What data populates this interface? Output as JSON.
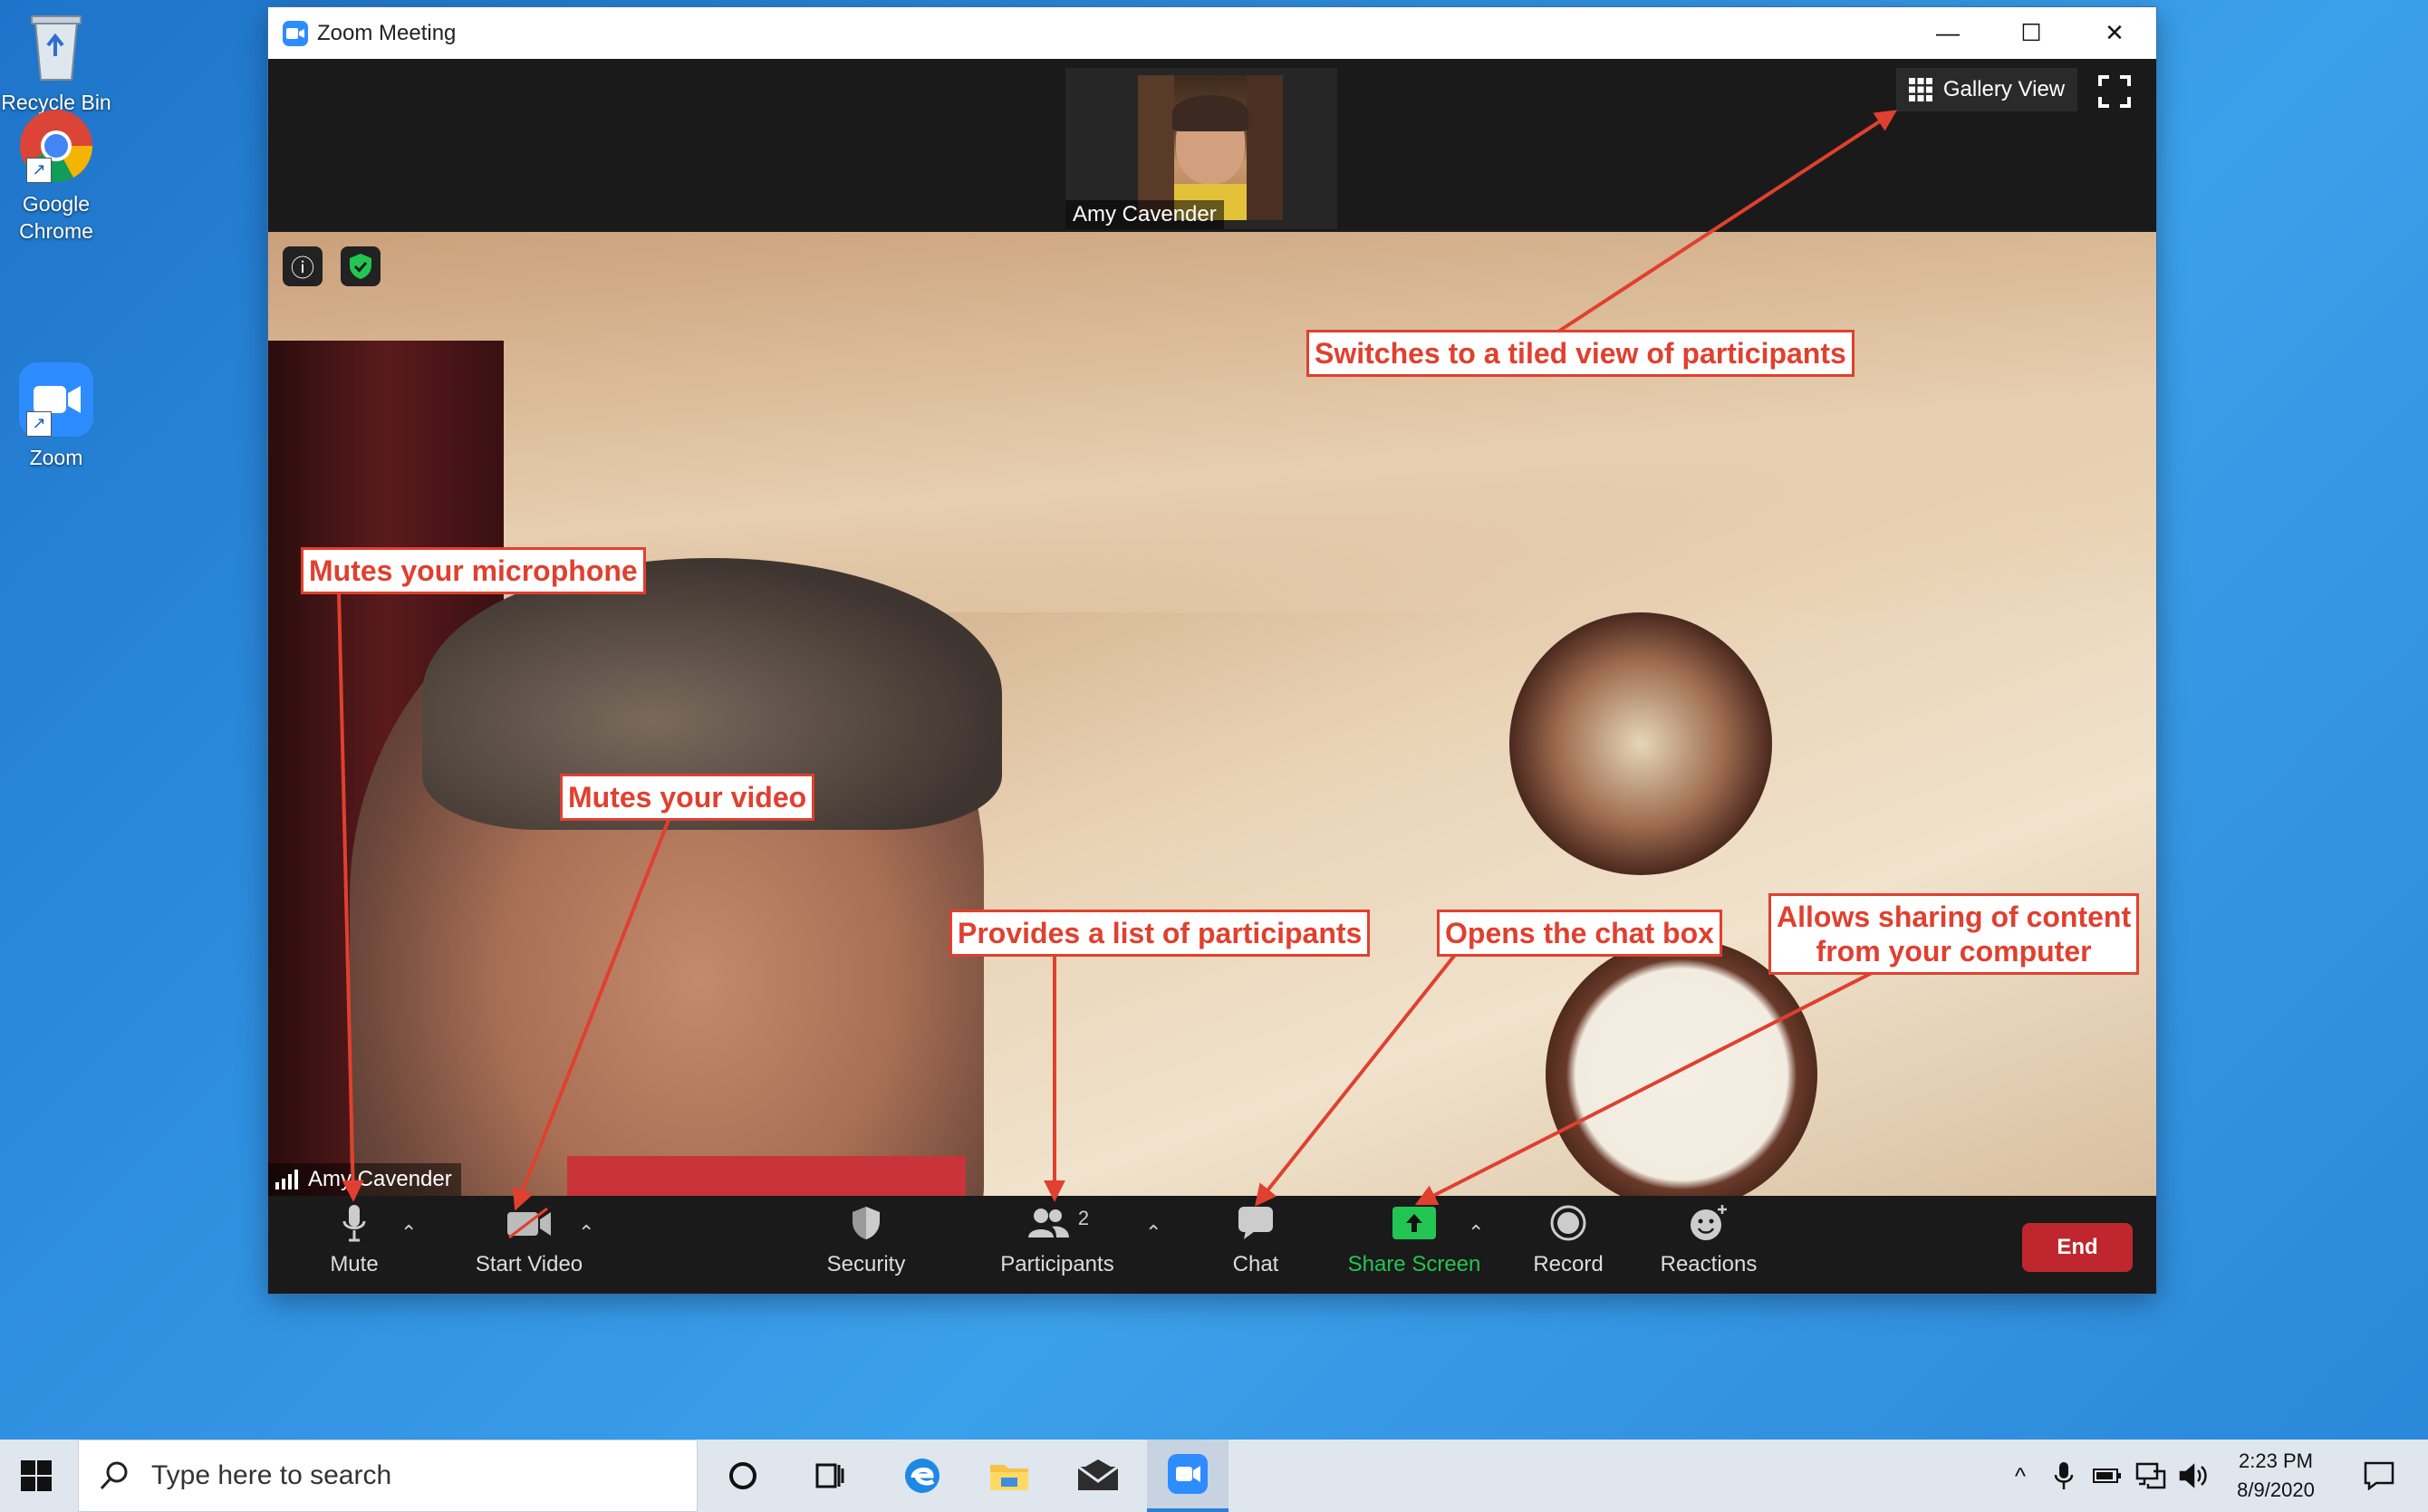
{
  "desktop": {
    "icons": [
      {
        "label": "Recycle Bin",
        "icon": "recycle-bin-icon"
      },
      {
        "label": "Google\nChrome",
        "label_line1": "Google",
        "label_line2": "Chrome",
        "icon": "chrome-icon"
      },
      {
        "label": "Zoom",
        "icon": "zoom-icon"
      }
    ]
  },
  "window": {
    "title": "Zoom Meeting",
    "controls": {
      "minimize": "—",
      "maximize": "☐",
      "close": "✕"
    }
  },
  "meeting": {
    "thumbnail_name": "Amy Cavender",
    "gallery_view_label": "Gallery View",
    "main_video_name": "Amy Cavender"
  },
  "toolbar": {
    "mute": "Mute",
    "start_video": "Start Video",
    "security": "Security",
    "participants": "Participants",
    "participants_count": "2",
    "chat": "Chat",
    "share_screen": "Share Screen",
    "record": "Record",
    "reactions": "Reactions",
    "end": "End"
  },
  "annotations": {
    "gallery": "Switches to a tiled view of participants",
    "mute": "Mutes your microphone",
    "video": "Mutes your video",
    "participants": "Provides a list of participants",
    "chat": "Opens the chat box",
    "share_line1": "Allows sharing of content",
    "share_line2": "from your computer"
  },
  "taskbar": {
    "search_placeholder": "Type here to search",
    "time": "2:23 PM",
    "date": "8/9/2020"
  },
  "colors": {
    "annotation": "#e0402f",
    "end_button": "#c0262d",
    "share_green": "#23c552",
    "zoom_blue": "#2d8cff"
  }
}
